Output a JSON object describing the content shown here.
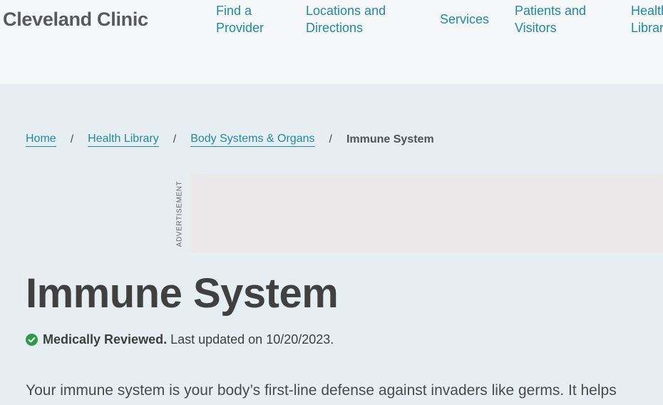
{
  "header": {
    "logo": "Cleveland Clinic",
    "nav": [
      {
        "line1": "Find a",
        "line2": "Provider"
      },
      {
        "line1": "Locations and",
        "line2": "Directions"
      },
      {
        "line1": "Services",
        "line2": ""
      },
      {
        "line1": "Patients and",
        "line2": "Visitors"
      },
      {
        "line1": "Health",
        "line2": "Library"
      }
    ]
  },
  "breadcrumb": {
    "items": [
      "Home",
      "Health Library",
      "Body Systems & Organs"
    ],
    "separator": "/",
    "current": "Immune System"
  },
  "ad": {
    "label": "ADVERTISEMENT"
  },
  "article": {
    "title": "Immune System",
    "review_strong": "Medically Reviewed.",
    "review_text": "Last updated on 10/20/2023.",
    "intro": "Your immune system is your body’s first-line defense against invaders like germs. It helps"
  },
  "colors": {
    "link": "#1f8aa6",
    "check": "#2f9a4a",
    "page_background": "#e6eef2",
    "header_background": "#f4f6f8"
  },
  "icons": {
    "review_status": "check-circle-icon"
  }
}
